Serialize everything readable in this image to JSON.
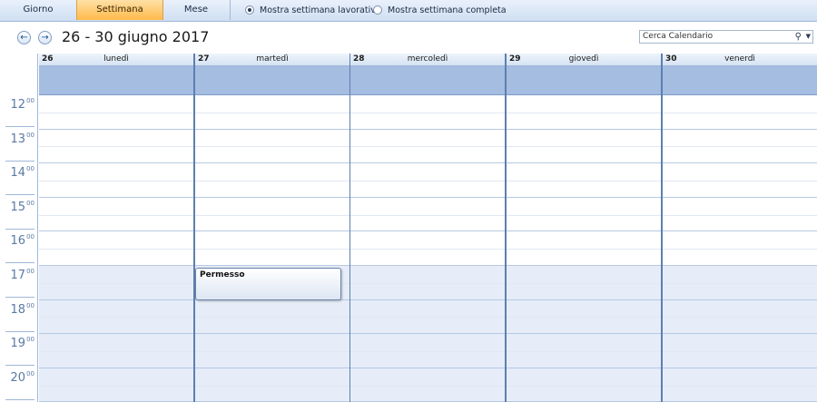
{
  "toolbar": {
    "views": [
      {
        "label": "Giorno",
        "active": false
      },
      {
        "label": "Settimana",
        "active": true
      },
      {
        "label": "Mese",
        "active": false
      }
    ],
    "options": [
      {
        "label": "Mostra settimana lavorativa",
        "selected": true
      },
      {
        "label": "Mostra settimana completa",
        "selected": false
      }
    ]
  },
  "header": {
    "date_range": "26 - 30 giugno 2017",
    "search_placeholder": "Cerca Calendario"
  },
  "days": [
    {
      "num": "26",
      "name": "lunedì"
    },
    {
      "num": "27",
      "name": "martedì"
    },
    {
      "num": "28",
      "name": "mercoledì"
    },
    {
      "num": "29",
      "name": "giovedì"
    },
    {
      "num": "30",
      "name": "venerdì"
    }
  ],
  "hours": [
    "12",
    "13",
    "14",
    "15",
    "16",
    "17",
    "18",
    "19",
    "20"
  ],
  "minutes_label": "00",
  "appointment": {
    "title": "Permesso",
    "day": "27",
    "start_hour": "17"
  },
  "colors": {
    "accent": "#ffb94a",
    "allday": "#a5bde0",
    "offhours": "#e6edf8",
    "gridline": "#5c7fb0"
  }
}
